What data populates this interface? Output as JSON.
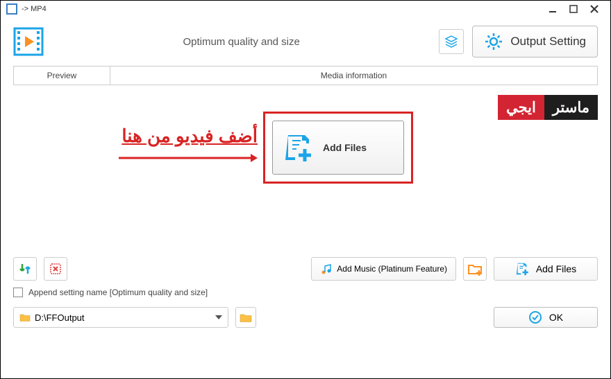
{
  "title": " -> MP4",
  "top": {
    "quality": "Optimum quality and size",
    "output_setting": "Output Setting"
  },
  "tabs": {
    "preview": "Preview",
    "media_info": "Media information"
  },
  "watermark": {
    "red": "ايجي",
    "black": "ماستر"
  },
  "annotation": "أضف فيديو من هنا",
  "addfiles_main": "Add Files",
  "buttons": {
    "add_music": "Add Music (Platinum Feature)",
    "add_files": "Add Files",
    "ok": "OK"
  },
  "checkbox_label": "Append setting name [Optimum quality and size]",
  "output_path": "D:\\FFOutput"
}
